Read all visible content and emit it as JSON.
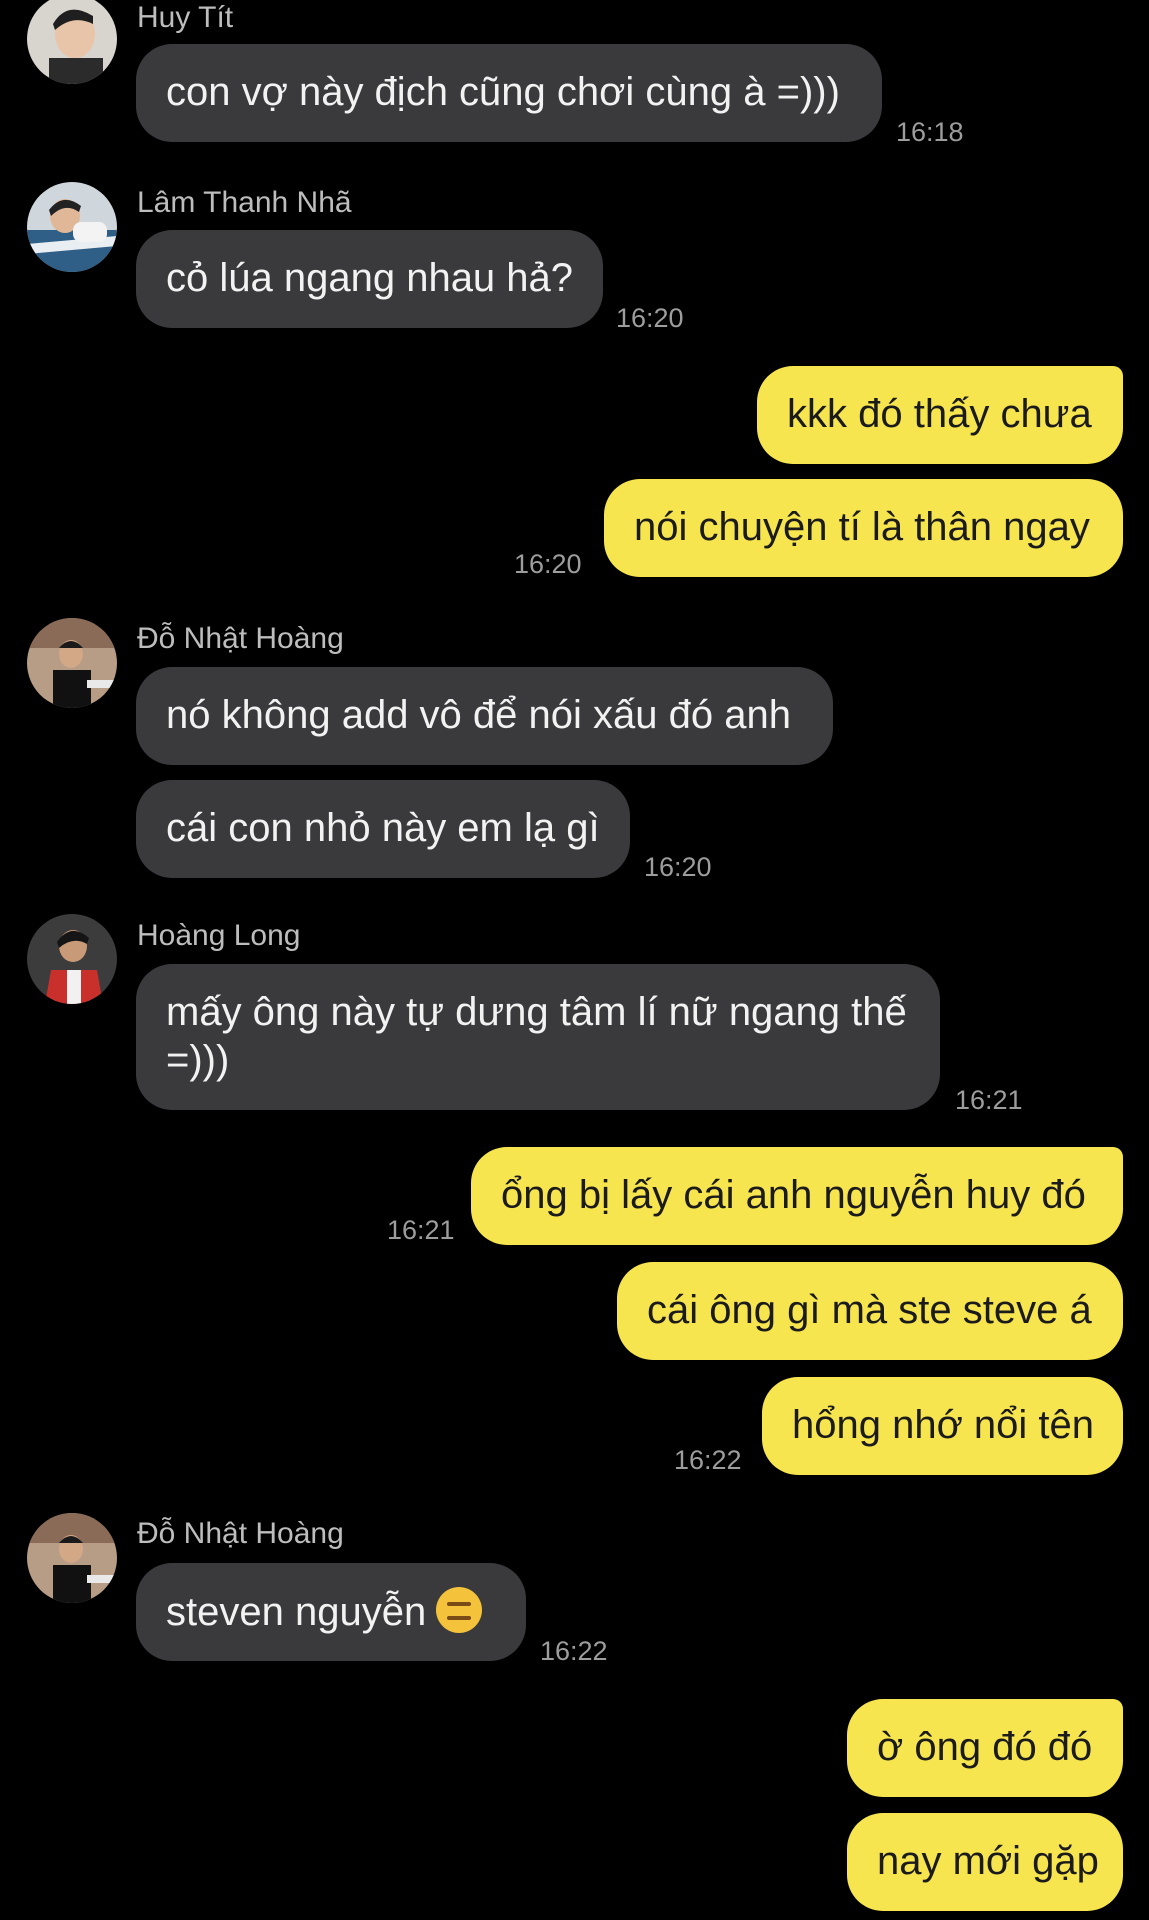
{
  "colors": {
    "background": "#000000",
    "incoming_bubble": "#3a3a3c",
    "outgoing_bubble": "#f7e54f",
    "timestamp": "#9d9d9d",
    "sender_name": "#bdbdbd"
  },
  "messages": [
    {
      "sender": "Huy Tít",
      "text": "con vợ này địch cũng chơi cùng à =)))",
      "time": "16:18"
    },
    {
      "sender": "Lâm Thanh Nhã",
      "text": "cỏ lúa ngang nhau hả?",
      "time": "16:20"
    },
    {
      "sender": "me",
      "text": "kkk đó thấy chưa"
    },
    {
      "sender": "me",
      "text": "nói chuyện tí là thân ngay",
      "time": "16:20"
    },
    {
      "sender": "Đỗ Nhật Hoàng",
      "text": "nó không add vô để nói xấu đó anh"
    },
    {
      "sender": "Đỗ Nhật Hoàng",
      "text": "cái con nhỏ này em lạ gì",
      "time": "16:20"
    },
    {
      "sender": "Hoàng Long",
      "text_line1": "mấy ông này tự dưng tâm lí nữ ngang thế",
      "text_line2": "=)))",
      "time": "16:21"
    },
    {
      "sender": "me",
      "text": "ổng bị lấy cái anh nguyễn huy đó",
      "time": "16:21"
    },
    {
      "sender": "me",
      "text": "cái ông gì mà ste steve á"
    },
    {
      "sender": "me",
      "text": "hổng nhớ nổi tên",
      "time": "16:22"
    },
    {
      "sender": "Đỗ Nhật Hoàng",
      "text": "steven nguyễn",
      "emoji": "expressionless-face-emoji",
      "time": "16:22"
    },
    {
      "sender": "me",
      "text": "ờ ông đó đó"
    },
    {
      "sender": "me",
      "text": "nay mới gặp"
    }
  ]
}
